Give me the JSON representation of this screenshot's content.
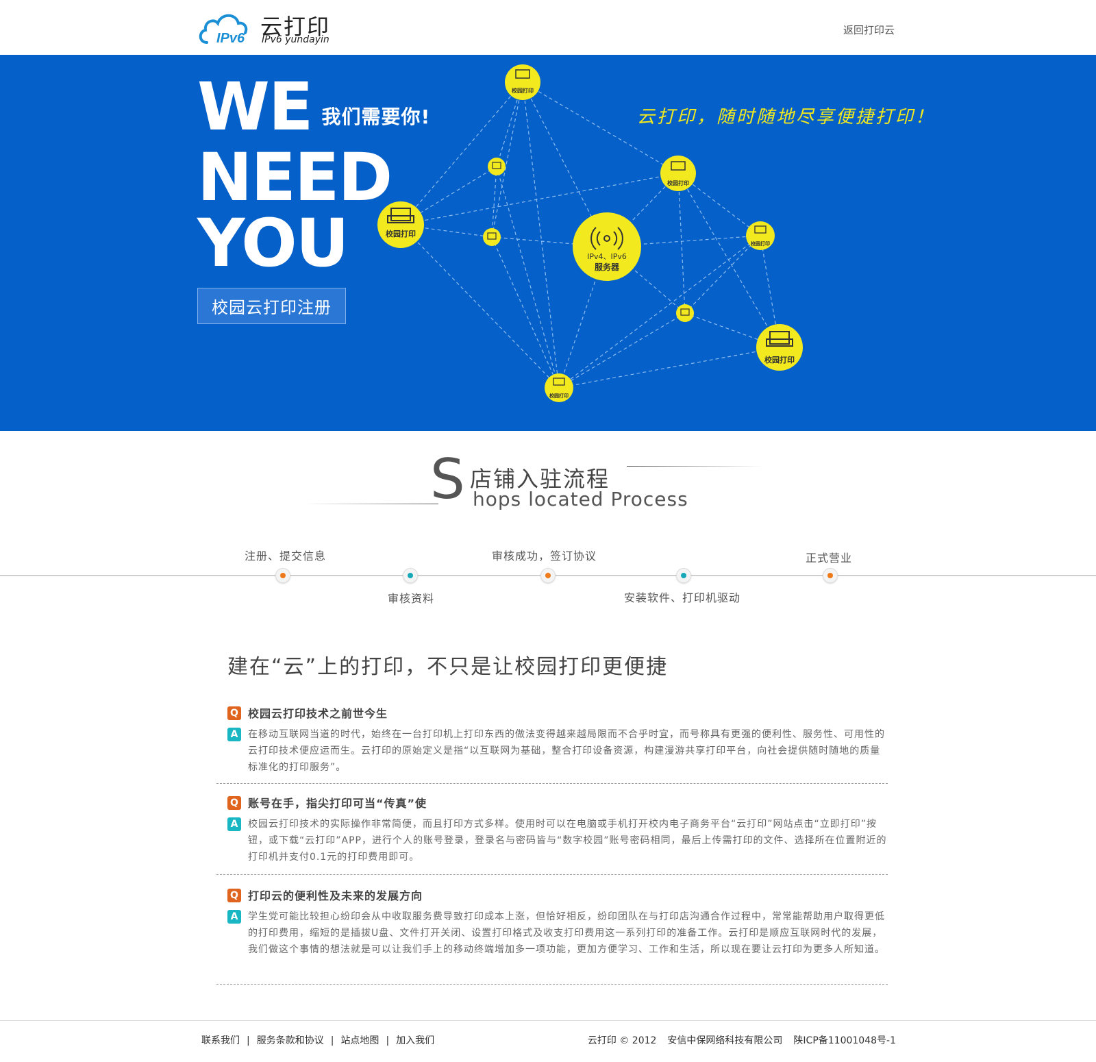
{
  "header": {
    "logo_badge": "IPv6",
    "logo_title": "云打印",
    "logo_subtitle": "IPv6  yundayin",
    "back_link": "返回打印云"
  },
  "banner": {
    "headline_1": "WE",
    "headline_tag": "我们需要你!",
    "headline_2": "NEED",
    "headline_3": "YOU",
    "register_button": "校园云打印注册",
    "slogan": "云打印，随时随地尽享便捷打印！",
    "server_label_1": "IPv4、IPv6",
    "server_label_2": "服务器",
    "node_label": "校园打印",
    "colors": {
      "background": "#0560c9",
      "node": "#f2ea1e"
    }
  },
  "process": {
    "big_letter": "S",
    "title_cn": "店铺入驻流程",
    "title_en": "hops located Process",
    "steps": [
      {
        "label": "注册、提交信息",
        "color": "orange"
      },
      {
        "label": "审核资料",
        "color": "teal"
      },
      {
        "label": "审核成功，签订协议",
        "color": "orange"
      },
      {
        "label": "安装软件、打印机驱动",
        "color": "teal"
      },
      {
        "label": "正式营业",
        "color": "orange"
      }
    ]
  },
  "article": {
    "title": "建在“云”上的打印，不只是让校园打印更便捷",
    "q_icon": "Q",
    "a_icon": "A",
    "items": [
      {
        "question": "校园云打印技术之前世今生",
        "answer": "在移动互联网当道的时代，始终在一台打印机上打印东西的做法变得越来越局限而不合乎时宜，而号称具有更强的便利性、服务性、可用性的云打印技术便应运而生。云打印的原始定义是指“以互联网为基础，整合打印设备资源，构建漫游共享打印平台，向社会提供随时随地的质量标准化的打印服务”。"
      },
      {
        "question": "账号在手，指尖打印可当“传真”使",
        "answer": "校园云打印技术的实际操作非常简便，而且打印方式多样。使用时可以在电脑或手机打开校内电子商务平台“云打印”网站点击“立即打印”按钮，或下载“云打印”APP，进行个人的账号登录，登录名与密码皆与“数字校园”账号密码相同，最后上传需打印的文件、选择所在位置附近的打印机并支付0.1元的打印费用即可。"
      },
      {
        "question": "打印云的便利性及未来的发展方向",
        "answer": "学生党可能比较担心纷印会从中收取服务费导致打印成本上涨，但恰好相反，纷印团队在与打印店沟通合作过程中，常常能帮助用户取得更低的打印费用，缩短的是插拔U盘、文件打开关闭、设置打印格式及收支打印费用这一系列打印的准备工作。云打印是顺应互联网时代的发展，我们做这个事情的想法就是可以让我们手上的移动终端增加多一项功能，更加方便学习、工作和生活，所以现在要让云打印为更多人所知道。"
      }
    ]
  },
  "footer": {
    "links": [
      "联系我们",
      "服务条款和协议",
      "站点地图",
      "加入我们"
    ],
    "separator": "|",
    "copyright": "云打印 © 2012",
    "company": "安信中保网络科技有限公司",
    "icp": "陕ICP备11001048号-1"
  }
}
